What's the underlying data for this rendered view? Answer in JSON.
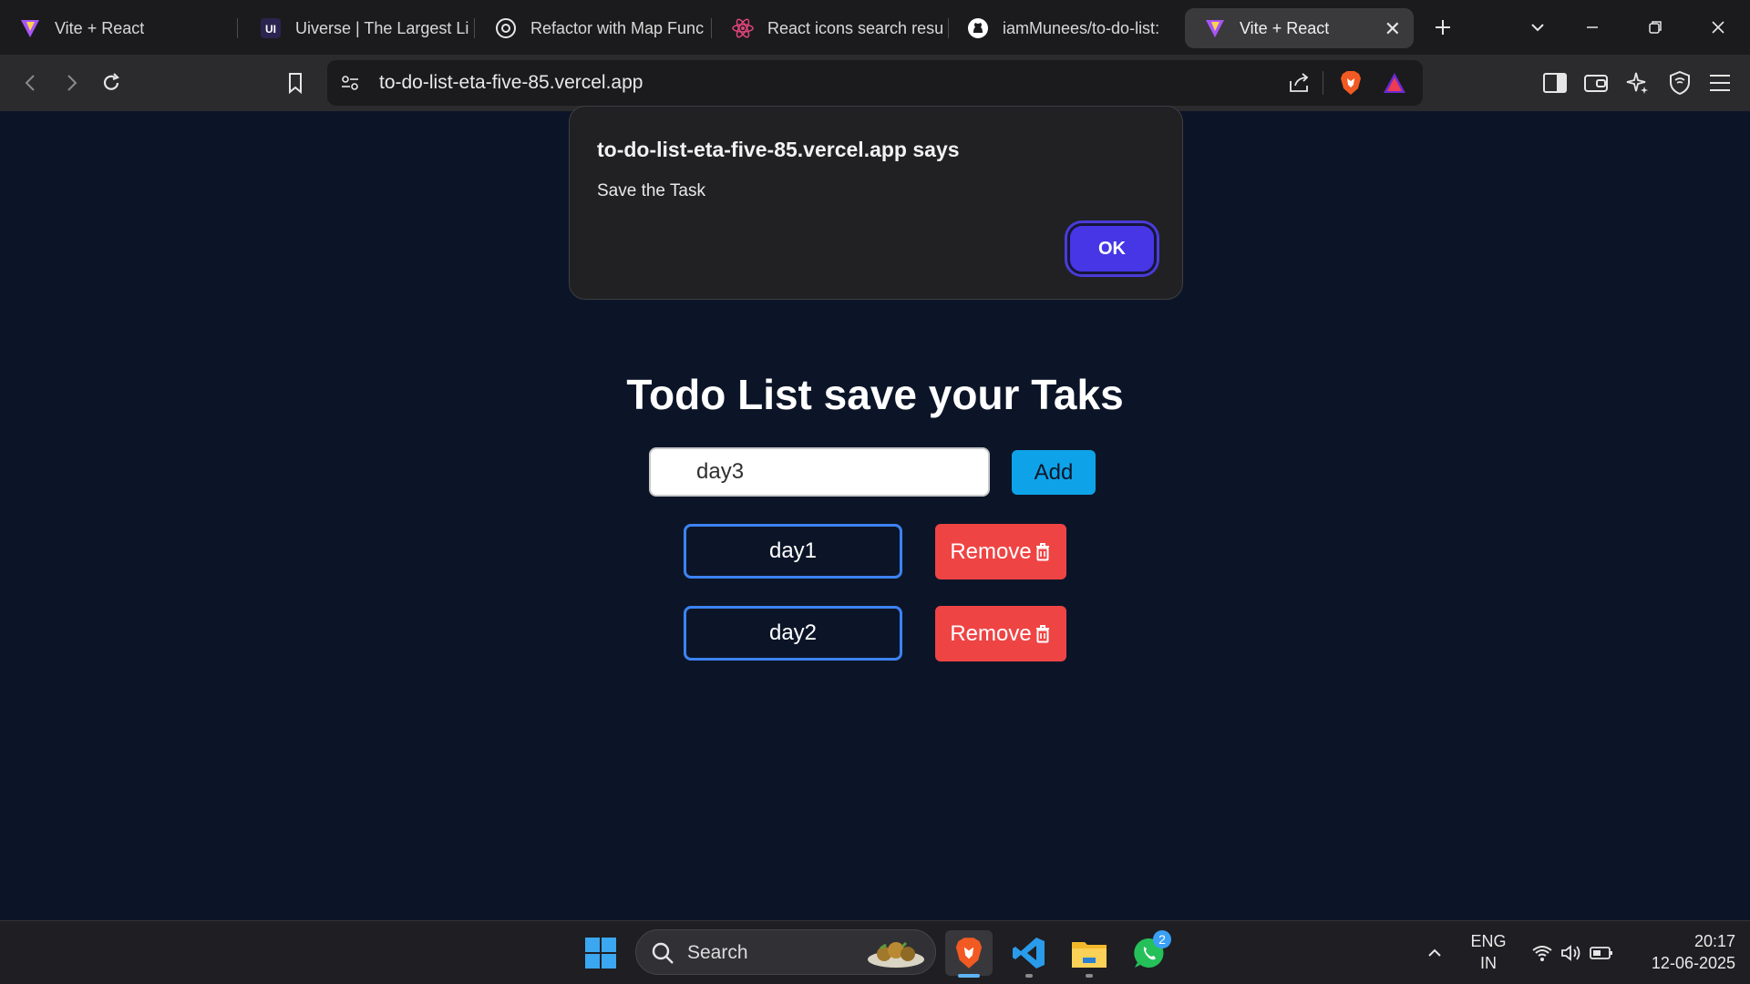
{
  "browser": {
    "tabs": [
      {
        "title": "Vite + React",
        "icon": "vite-icon"
      },
      {
        "title": "Uiverse | The Largest Li",
        "icon": "uiverse-icon"
      },
      {
        "title": "Refactor with Map Func",
        "icon": "chatgpt-icon"
      },
      {
        "title": "React icons search resu",
        "icon": "react-icon"
      },
      {
        "title": "iamMunees/to-do-list:",
        "icon": "github-icon"
      },
      {
        "title": "Vite + React",
        "icon": "vite-icon",
        "active": true
      }
    ],
    "url": "to-do-list-eta-five-85.vercel.app"
  },
  "dialog": {
    "title": "to-do-list-eta-five-85.vercel.app says",
    "message": "Save the Task",
    "ok_label": "OK"
  },
  "app": {
    "heading": "Todo List save your Taks",
    "input_value": "day3",
    "add_label": "Add",
    "tasks": [
      {
        "text": "day1",
        "remove_label": "Remove"
      },
      {
        "text": "day2",
        "remove_label": "Remove"
      }
    ]
  },
  "taskbar": {
    "search_label": "Search",
    "whatsapp_badge": "2",
    "language": "ENG",
    "region": "IN",
    "time": "20:17",
    "date": "12-06-2025"
  },
  "colors": {
    "page_bg": "#0c1528",
    "add_button": "#0ea3e8",
    "remove_button": "#ef4444",
    "task_border": "#3d83f2",
    "ok_button": "#4636e6"
  }
}
